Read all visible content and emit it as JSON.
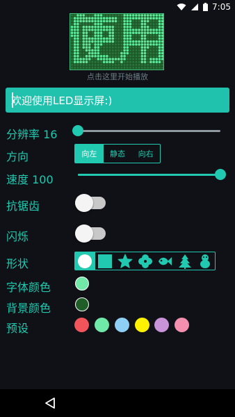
{
  "status_bar": {
    "time": "7:05",
    "icons": [
      "wifi-icon",
      "signal-icon",
      "battery-icon"
    ]
  },
  "preview": {
    "hint": "点击这里开始播放",
    "led_text": "使用",
    "background_color": "#1e5a2a",
    "dot_color": "#5ee89a"
  },
  "text_input": {
    "value": "欢迎使用LED显示屏:)"
  },
  "resolution": {
    "label": "分辨率 16",
    "value_fraction": 0.0
  },
  "direction": {
    "label": "方向",
    "options": [
      "向左",
      "静态",
      "向右"
    ],
    "selected": "向左"
  },
  "speed": {
    "label": "速度 100",
    "value_fraction": 1.0
  },
  "antialias": {
    "label": "抗锯齿",
    "on": false
  },
  "flash": {
    "label": "闪烁",
    "on": false
  },
  "shape": {
    "label": "形状",
    "options": [
      "circle-icon",
      "square-icon",
      "star-icon",
      "clover-icon",
      "fish-icon",
      "tree-icon",
      "penguin-icon"
    ],
    "selected": "circle-icon"
  },
  "font_color": {
    "label": "字体颜色",
    "color": "#6fe8a8"
  },
  "bg_color": {
    "label": "背景颜色",
    "color": "#1f5e27"
  },
  "presets": {
    "label": "预设",
    "colors": [
      "#f2545b",
      "#6fe8a8",
      "#8ecff6",
      "#fff200",
      "#c893d8",
      "#f58fb0"
    ]
  },
  "theme": {
    "accent": "#20c9b0",
    "background": "#0f1116"
  }
}
